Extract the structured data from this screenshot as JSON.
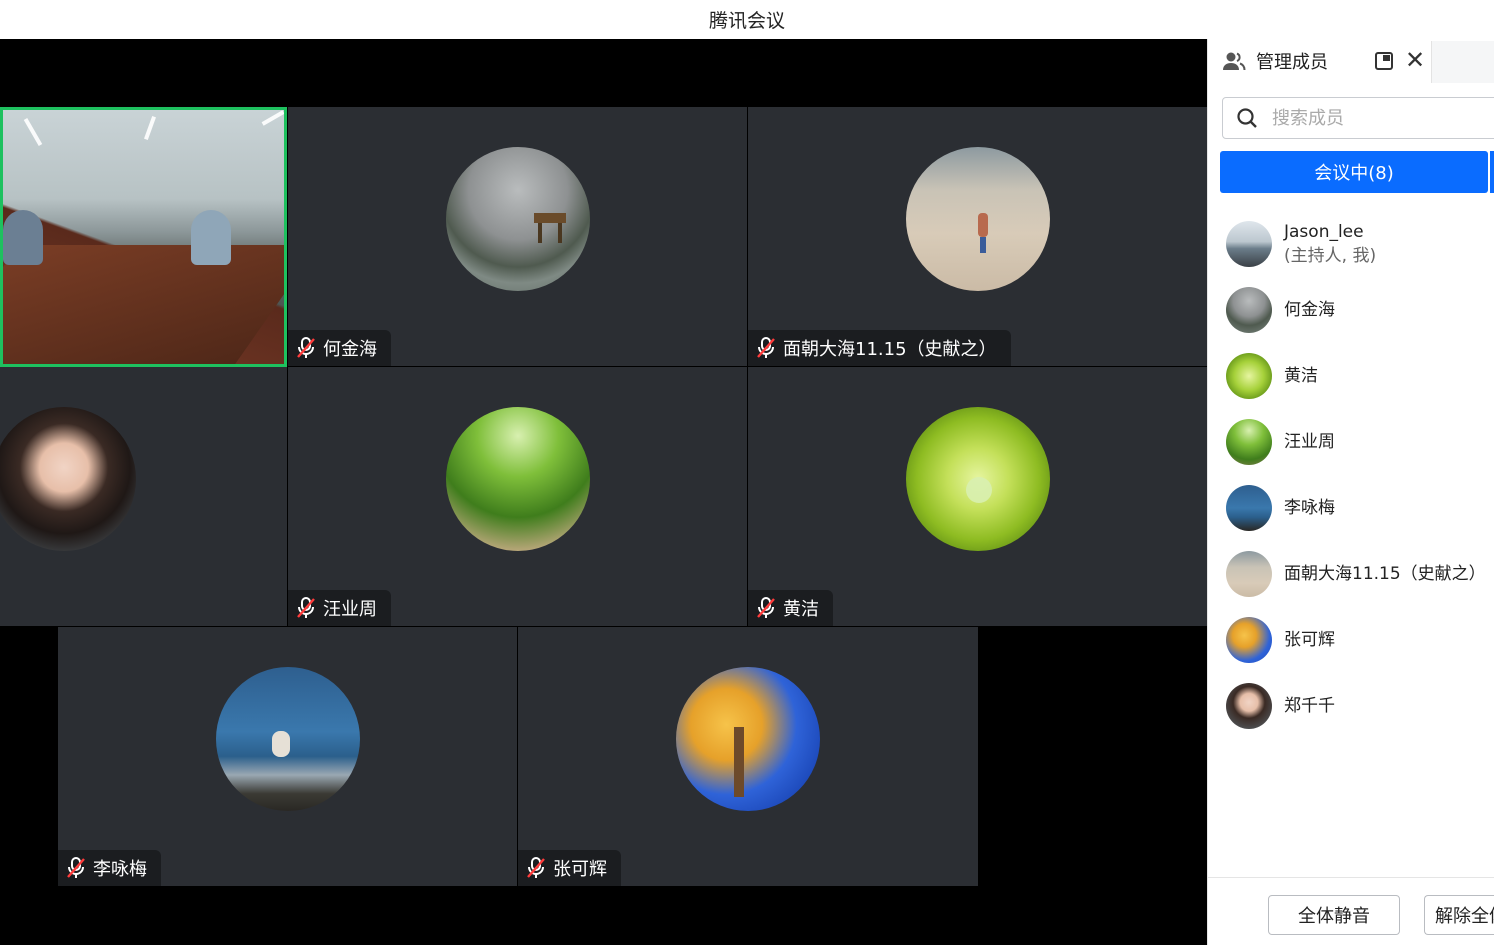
{
  "window": {
    "title": "腾讯会议"
  },
  "tiles": [
    {
      "name": "",
      "muted": false,
      "selected": true
    },
    {
      "name": "何金海",
      "muted": true
    },
    {
      "name": "面朝大海11.15（史献之）",
      "muted": true
    },
    {
      "name": "",
      "muted": false
    },
    {
      "name": "汪业周",
      "muted": true
    },
    {
      "name": "黄洁",
      "muted": true
    },
    {
      "name": "李咏梅",
      "muted": true
    },
    {
      "name": "张可辉",
      "muted": true
    }
  ],
  "panel": {
    "title": "管理成员",
    "search_placeholder": "搜索成员",
    "tab_label": "会议中(8)",
    "members": [
      {
        "name": "Jason_lee",
        "sub": "(主持人, 我)"
      },
      {
        "name": "何金海"
      },
      {
        "name": "黄洁"
      },
      {
        "name": "汪业周"
      },
      {
        "name": "李咏梅"
      },
      {
        "name": "面朝大海11.15（史献之）"
      },
      {
        "name": "张可辉"
      },
      {
        "name": "郑千千"
      }
    ],
    "mute_all_label": "全体静音",
    "unmute_all_label": "解除全体静音"
  },
  "colors": {
    "accent": "#0a6cff",
    "active_speaker": "#1ec15f",
    "tile_bg": "#2b2e33"
  }
}
